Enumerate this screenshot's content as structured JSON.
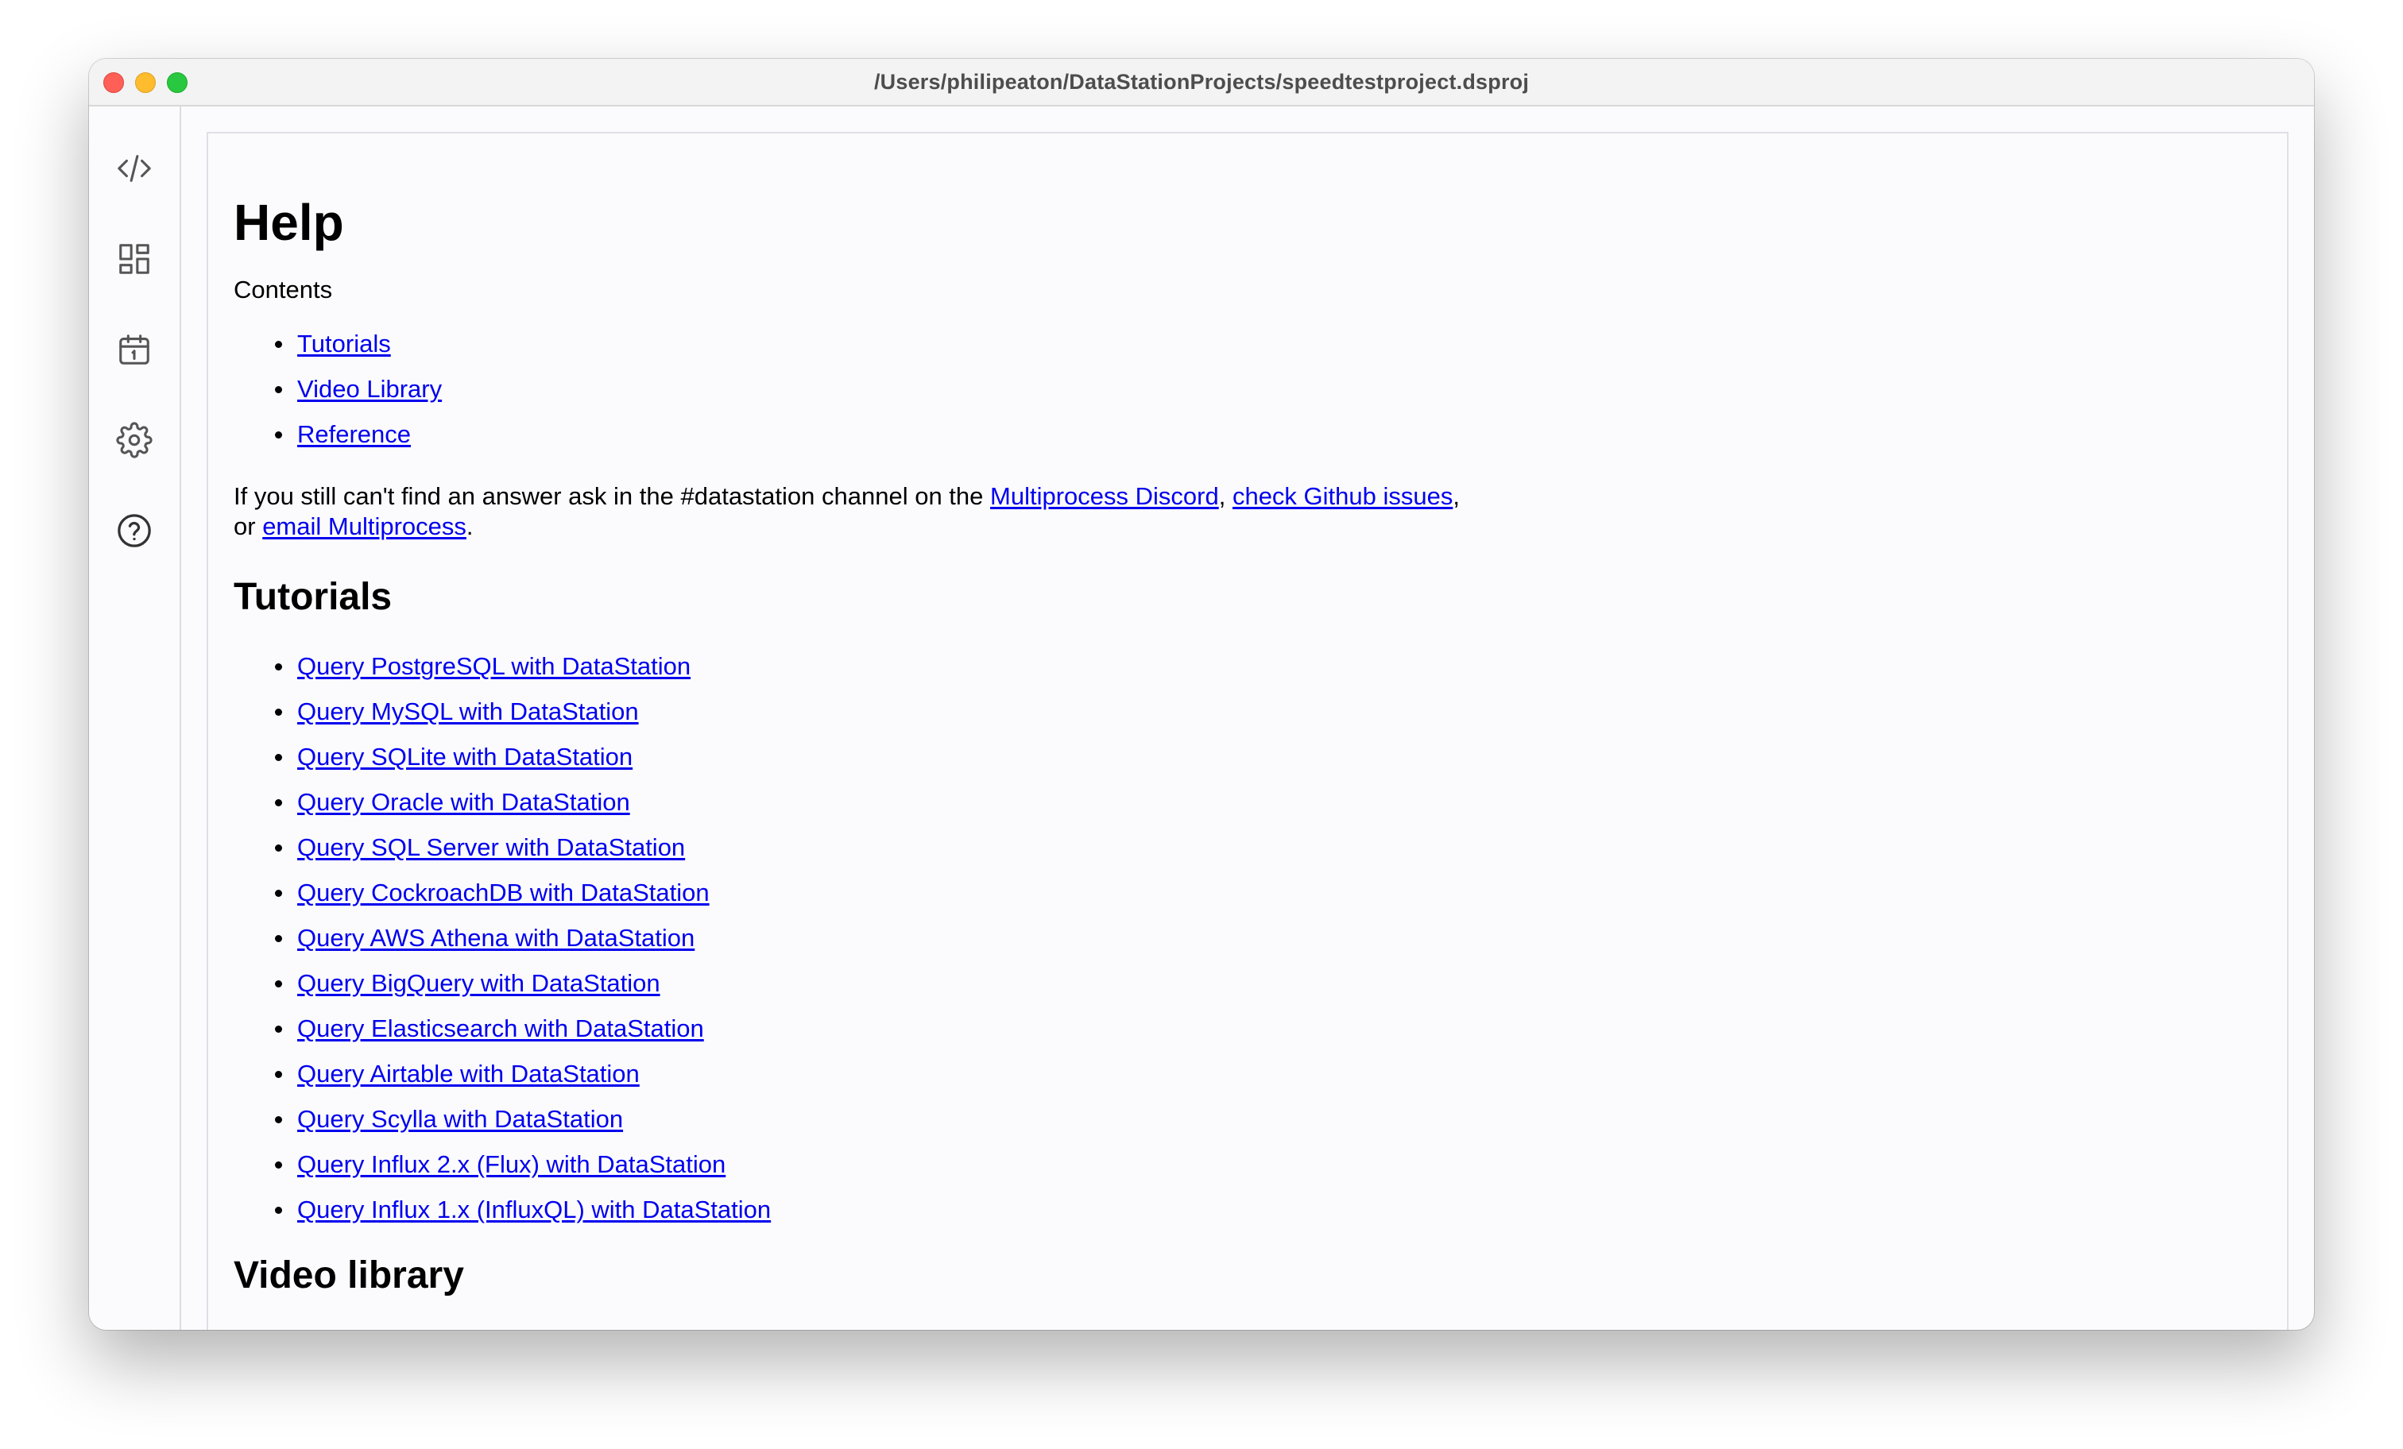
{
  "window": {
    "title": "/Users/philipeaton/DataStationProjects/speedtestproject.dsproj"
  },
  "sidebar": {
    "icons": [
      {
        "name": "code-icon"
      },
      {
        "name": "dashboard-icon"
      },
      {
        "name": "calendar-icon"
      },
      {
        "name": "gear-icon"
      },
      {
        "name": "help-icon"
      }
    ]
  },
  "help": {
    "title": "Help",
    "contents_label": "Contents",
    "contents_links": [
      "Tutorials",
      "Video Library",
      "Reference"
    ],
    "support": {
      "text_before": "If you still can't find an answer ask in the #datastation channel on the ",
      "discord_link": "Multiprocess Discord",
      "sep1": ", ",
      "github_link": "check Github issues",
      "sep2": ",",
      "text_or": "or ",
      "email_link": "email Multiprocess",
      "end": "."
    },
    "tutorials_heading": "Tutorials",
    "tutorials": [
      "Query PostgreSQL with DataStation",
      "Query MySQL with DataStation",
      "Query SQLite with DataStation",
      "Query Oracle with DataStation",
      "Query SQL Server with DataStation",
      "Query CockroachDB with DataStation",
      "Query AWS Athena with DataStation",
      "Query BigQuery with DataStation",
      "Query Elasticsearch with DataStation",
      "Query Airtable with DataStation",
      "Query Scylla with DataStation",
      "Query Influx 2.x (Flux) with DataStation",
      "Query Influx 1.x (InfluxQL) with DataStation"
    ],
    "video_heading": "Video library"
  },
  "colors": {
    "link": "#0000ee",
    "close": "#fe5f57",
    "minimize": "#febc2e",
    "maximize": "#28c840",
    "icon": "#555555"
  }
}
